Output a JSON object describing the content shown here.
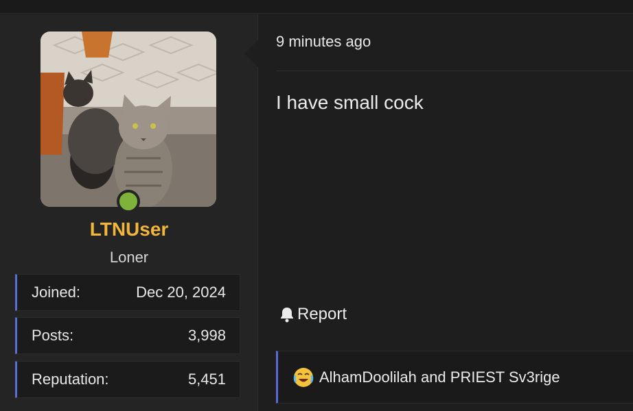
{
  "user": {
    "username": "LTNUser",
    "title": "Loner",
    "online": true,
    "stats": [
      {
        "label": "Joined:",
        "value": "Dec 20, 2024"
      },
      {
        "label": "Posts:",
        "value": "3,998"
      },
      {
        "label": "Reputation:",
        "value": "5,451"
      }
    ]
  },
  "post": {
    "time": "9 minutes ago",
    "body": "I have small cock",
    "report_label": "Report",
    "reactions_text": "AlhamDoolilah and PRIEST Sv3rige"
  },
  "colors": {
    "accent": "#5b6bd8",
    "username": "#f2b63c",
    "online": "#7fb23a"
  },
  "icons": {
    "report": "bell-icon",
    "reaction": "laughing-crying-emoji-icon"
  }
}
